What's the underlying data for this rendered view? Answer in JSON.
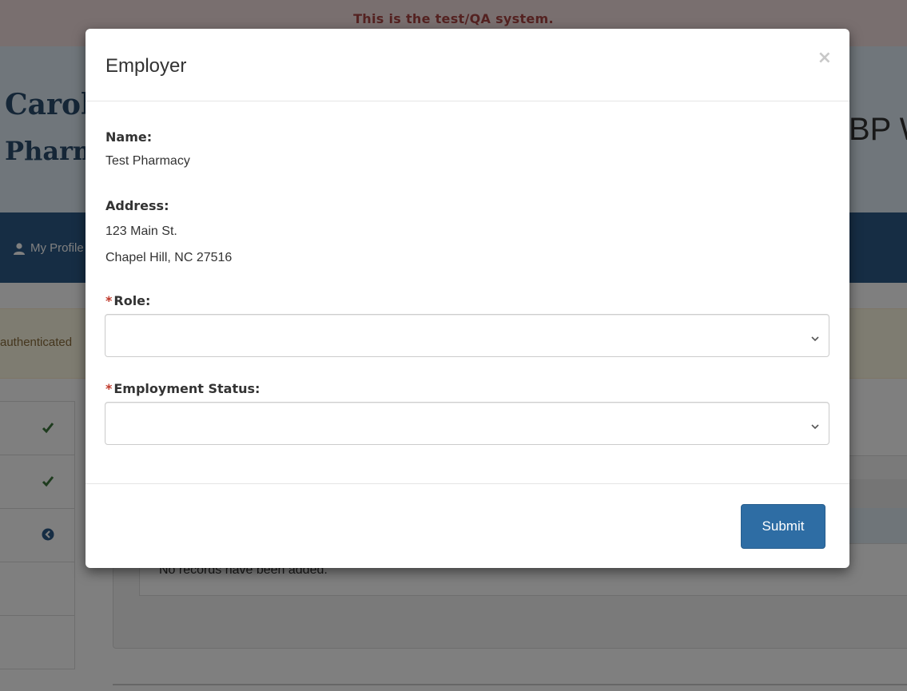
{
  "banner": {
    "text": "This is the test/QA system."
  },
  "header": {
    "brand_line1": "Carolina",
    "brand_line2": "Pharmacy",
    "right_text": "BP W"
  },
  "nav": {
    "my_profile": "My Profile"
  },
  "alert": {
    "text": "authenticated"
  },
  "side_items": [
    {
      "icon": "check-icon"
    },
    {
      "icon": "check-icon"
    },
    {
      "icon": "arrow-circle-left-icon"
    },
    {
      "icon": ""
    },
    {
      "icon": ""
    }
  ],
  "records_panel": {
    "empty_text": "No records have been added."
  },
  "modal": {
    "title": "Employer",
    "close_label": "×",
    "name_label": "Name:",
    "name_value": "Test Pharmacy",
    "address_label": "Address:",
    "address_line1": "123 Main St.",
    "address_line2": "Chapel Hill, NC 27516",
    "required_marker": "*",
    "role_label": "Role:",
    "role_value": "",
    "employment_status_label": "Employment Status:",
    "employment_status_value": "",
    "submit_label": "Submit"
  },
  "colors": {
    "banner_bg": "#f2dede",
    "banner_text": "#a94442",
    "navbar": "#2c5a88",
    "primary_button": "#2e6da4",
    "required": "#c0392b",
    "check": "#3c763d"
  }
}
